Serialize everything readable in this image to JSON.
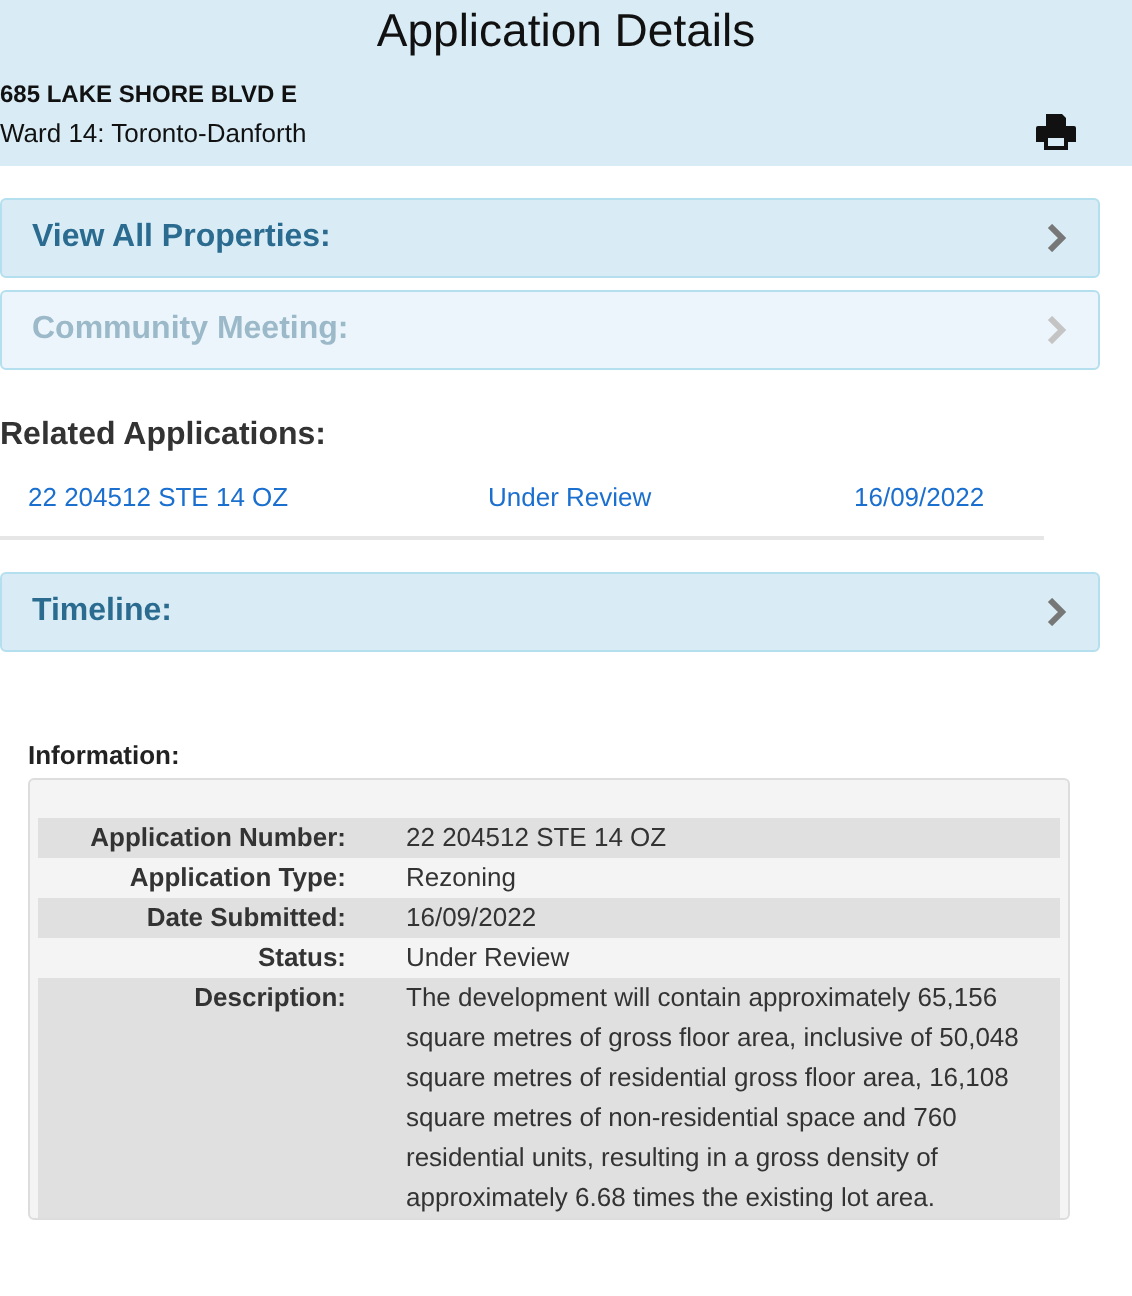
{
  "header": {
    "title": "Application Details",
    "address": "685 LAKE SHORE BLVD E",
    "ward": "Ward 14: Toronto-Danforth"
  },
  "panels_top": [
    {
      "label": "View All Properties:",
      "disabled": false
    },
    {
      "label": "Community Meeting:",
      "disabled": true
    }
  ],
  "related": {
    "heading": "Related Applications:",
    "rows": [
      {
        "number": "22 204512 STE 14 OZ",
        "status": "Under Review",
        "date": "16/09/2022"
      }
    ]
  },
  "panels_bottom": [
    {
      "label": "Timeline:",
      "disabled": false
    }
  ],
  "information": {
    "heading": "Information:",
    "rows": [
      {
        "label": "Application Number:",
        "value": "22 204512 STE 14 OZ"
      },
      {
        "label": "Application Type:",
        "value": "Rezoning"
      },
      {
        "label": "Date Submitted:",
        "value": "16/09/2022"
      },
      {
        "label": "Status:",
        "value": "Under Review"
      },
      {
        "label": "Description:",
        "value": "The development will contain approximately 65,156 square metres of gross floor area, inclusive of 50,048 square metres of residential gross floor area, 16,108 square metres of non-residential space and 760 residential units, resulting in a gross density of approximately 6.68 times the existing lot area."
      }
    ]
  }
}
